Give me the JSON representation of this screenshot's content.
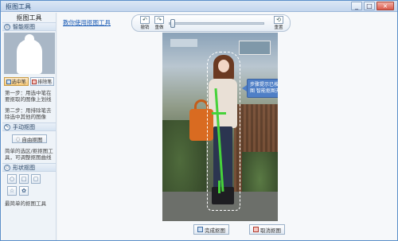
{
  "window": {
    "title": "抠图工具",
    "controls": [
      "_",
      "□",
      "×"
    ]
  },
  "sidebar": {
    "heading": "抠图工具",
    "smart": {
      "title": "智能抠图",
      "keep_label": "选中笔",
      "erase_label": "排除笔",
      "step1": "第一步：用选中笔在要抠取的图像上划线",
      "step2": "第二步：用排除笔去除选中其他的图像"
    },
    "manual": {
      "title": "手动抠图",
      "free_label": "自由抠图",
      "desc": "简单的选区/抠抠图工具，可调整抠图曲线"
    },
    "shape": {
      "title": "形状抠图",
      "desc": "最简单的抠图工具"
    }
  },
  "main": {
    "help_link": "教你使用抠图工具",
    "toolbar": {
      "undo": "撤销",
      "redo": "重做",
      "reset": "重置"
    },
    "tooltip": "步骤提示已按照下图\n智能抠图无效",
    "done_label": "完成抠图",
    "cancel_label": "取消抠图"
  },
  "colors": {
    "accent": "#1a5bb5",
    "trace": "#46d23a",
    "bag": "#d96b21"
  }
}
